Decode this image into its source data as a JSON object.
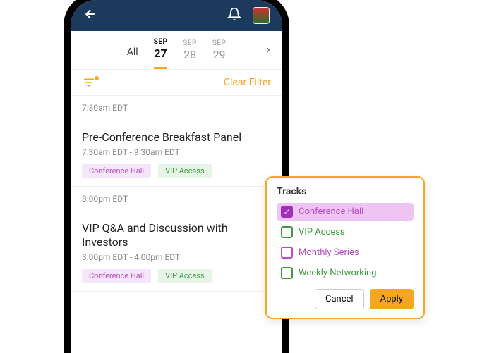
{
  "header": {},
  "dateTabs": {
    "all": "All",
    "items": [
      {
        "month": "SEP",
        "day": "27"
      },
      {
        "month": "SEP",
        "day": "28"
      },
      {
        "month": "SEP",
        "day": "29"
      }
    ]
  },
  "filterbar": {
    "clear": "Clear Filter"
  },
  "times": {
    "t1": "7:30am EDT",
    "t2": "3:00pm EDT"
  },
  "sessions": {
    "s1": {
      "title": "Pre-Conference Breakfast Panel",
      "time": "7:30am EDT - 9:30am EDT",
      "tag1": "Conference Hall",
      "tag2": "VIP Access"
    },
    "s2": {
      "title": "VIP Q&A and Discussion with Investors",
      "time": "3:00pm EDT - 4:00pm EDT",
      "tag1": "Conference Hall",
      "tag2": "VIP Access"
    }
  },
  "tracks": {
    "title": "Tracks",
    "opts": {
      "o1": "Conference Hall",
      "o2": "VIP Access",
      "o3": "Monthly Series",
      "o4": "Weekly Networking"
    },
    "cancel": "Cancel",
    "apply": "Apply"
  }
}
